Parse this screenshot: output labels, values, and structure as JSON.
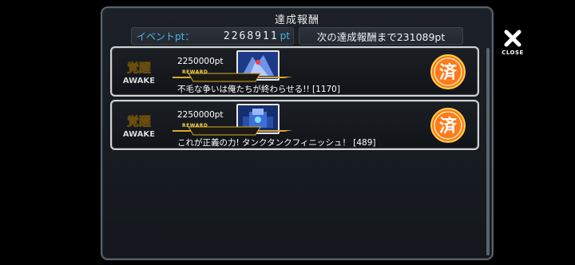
{
  "panel": {
    "title": "達成報酬",
    "event_pt_label": "イベントpt：",
    "event_pt_value": "2268911",
    "event_pt_unit": "pt",
    "next_reward_text": "次の達成報酬まで231089pt"
  },
  "rewards": [
    {
      "pt": "2250000pt",
      "reward_label": "REWARD",
      "name": "不毛な争いは俺たちが終わらせる!! [1170]",
      "status": "済"
    },
    {
      "pt": "2250000pt",
      "reward_label": "REWARD",
      "name": "これが正義の力! タンクタンクフィニッシュ！ [489]",
      "status": "済"
    }
  ],
  "close": {
    "label": "CLOSE"
  },
  "logo": {
    "kanji": "覚醒",
    "text": "AWAKE"
  },
  "colors": {
    "accent_blue": "#4bb6e6",
    "gold": "#d7a732",
    "stamp_orange": "#ff6a1a"
  }
}
